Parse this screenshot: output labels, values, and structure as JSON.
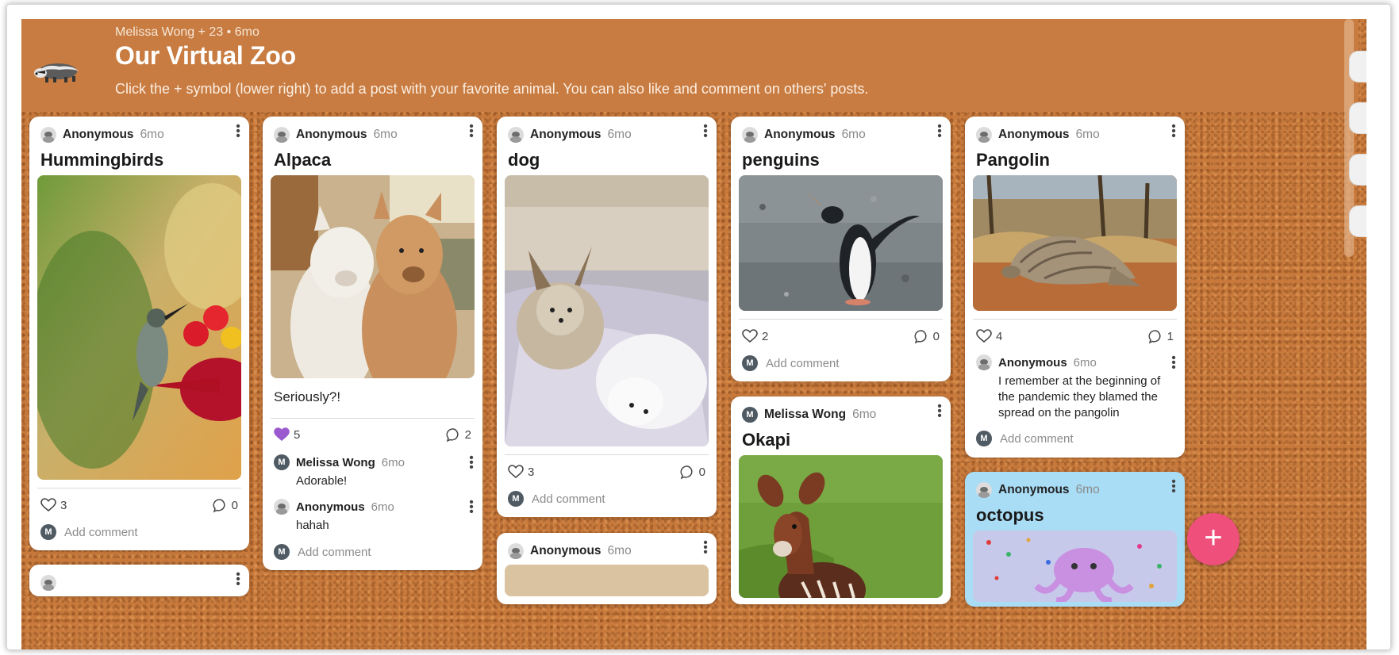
{
  "board": {
    "meta": "Melissa Wong + 23 • 6mo",
    "title": "Our Virtual Zoo",
    "description": "Click the + symbol (lower right) to add a post with your favorite animal. You can also like and comment on others' posts.",
    "logo_icon": "badger-icon"
  },
  "cards": [
    {
      "author": "Anonymous",
      "time": "6mo",
      "title": "Hummingbirds",
      "image": "hummingbird at feeder",
      "likes": "3",
      "comments": "0",
      "add_comment": "Add comment"
    },
    {
      "author": "Anonymous",
      "time": "6mo",
      "title": "Alpaca",
      "image": "two alpacas",
      "body": "Seriously?!",
      "likes": "5",
      "comments": "2",
      "add_comment": "Add comment",
      "replies": [
        {
          "author": "Melissa Wong",
          "time": "6mo",
          "text": "Adorable!",
          "avatar": "M"
        },
        {
          "author": "Anonymous",
          "time": "6mo",
          "text": "hahah"
        }
      ]
    },
    {
      "author": "Anonymous",
      "time": "6mo",
      "title": "dog",
      "image": "two small dogs on bed",
      "likes": "3",
      "comments": "0",
      "add_comment": "Add comment"
    },
    {
      "author": "Anonymous",
      "time": "6mo",
      "title": "penguins",
      "image": "penguin on gravel",
      "likes": "2",
      "comments": "0",
      "add_comment": "Add comment"
    },
    {
      "author": "Anonymous",
      "time": "6mo",
      "title": "Pangolin",
      "image": "pangolin walking",
      "likes": "4",
      "comments": "1",
      "add_comment": "Add comment",
      "replies": [
        {
          "author": "Anonymous",
          "time": "6mo",
          "text": "I remember at the beginning of the pandemic they blamed the spread on the pangolin"
        }
      ]
    },
    {
      "author": "Melissa Wong",
      "time": "6mo",
      "title": "Okapi",
      "image": "okapi in grass",
      "avatar": "M"
    },
    {
      "author": "Anonymous",
      "time": "6mo",
      "title": "octopus",
      "image": "octopus illustration with confetti"
    },
    {
      "author": "Anonymous",
      "time": "6mo"
    }
  ],
  "fab_label": "+",
  "colors": {
    "header": "#c87c41",
    "cork": "#c87a3c",
    "fab": "#ef4f7b",
    "liked": "#9b59d0",
    "octopus_card": "#a9ddf6"
  }
}
